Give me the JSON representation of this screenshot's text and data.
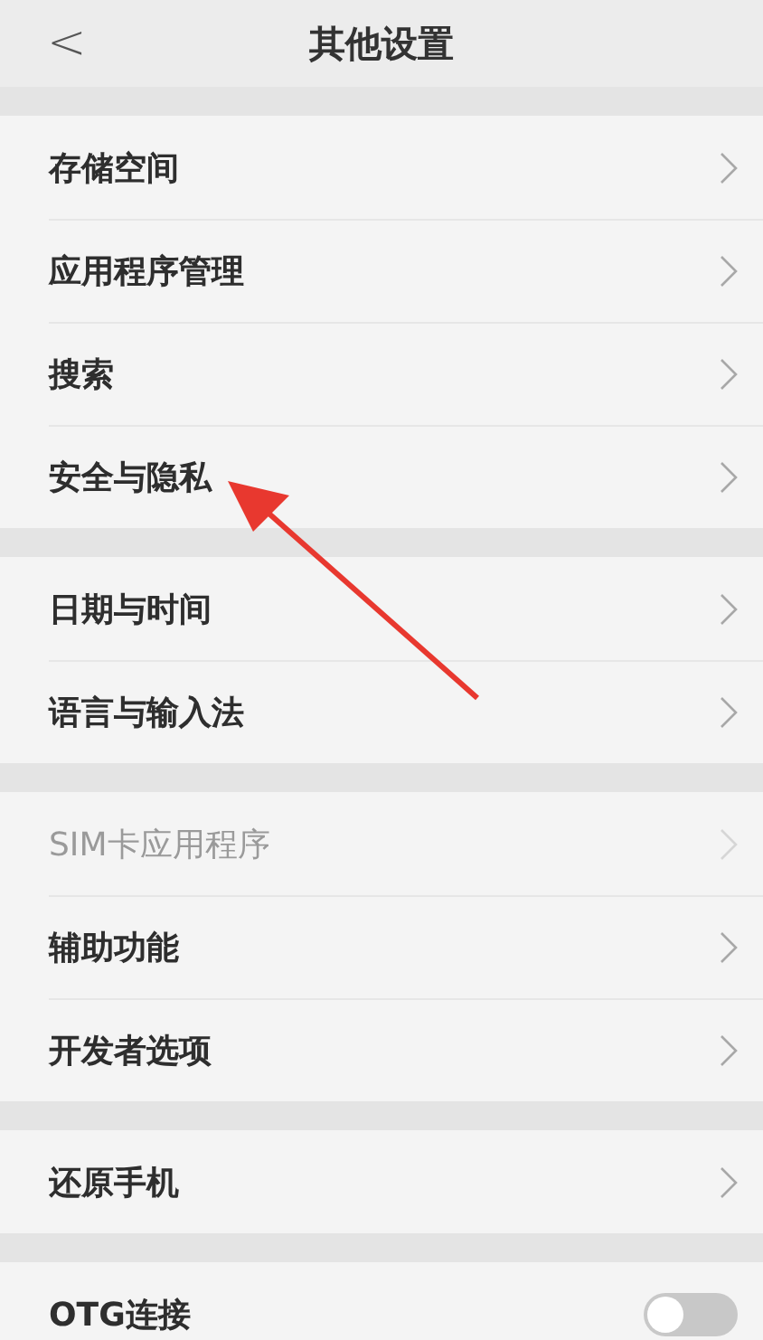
{
  "header": {
    "back": "<",
    "title": "其他设置"
  },
  "groups": [
    {
      "items": [
        {
          "label": "存储空间",
          "kind": "link",
          "disabled": false
        },
        {
          "label": "应用程序管理",
          "kind": "link",
          "disabled": false
        },
        {
          "label": "搜索",
          "kind": "link",
          "disabled": false
        },
        {
          "label": "安全与隐私",
          "kind": "link",
          "disabled": false
        }
      ]
    },
    {
      "items": [
        {
          "label": "日期与时间",
          "kind": "link",
          "disabled": false
        },
        {
          "label": "语言与输入法",
          "kind": "link",
          "disabled": false
        }
      ]
    },
    {
      "items": [
        {
          "label": "SIM卡应用程序",
          "kind": "link",
          "disabled": true
        },
        {
          "label": "辅助功能",
          "kind": "link",
          "disabled": false
        },
        {
          "label": "开发者选项",
          "kind": "link",
          "disabled": false
        }
      ]
    },
    {
      "items": [
        {
          "label": "还原手机",
          "kind": "link",
          "disabled": false
        }
      ]
    },
    {
      "items": [
        {
          "label": "OTG连接",
          "kind": "toggle",
          "on": false,
          "disabled": false
        }
      ]
    }
  ],
  "annotation": {
    "kind": "arrow"
  }
}
